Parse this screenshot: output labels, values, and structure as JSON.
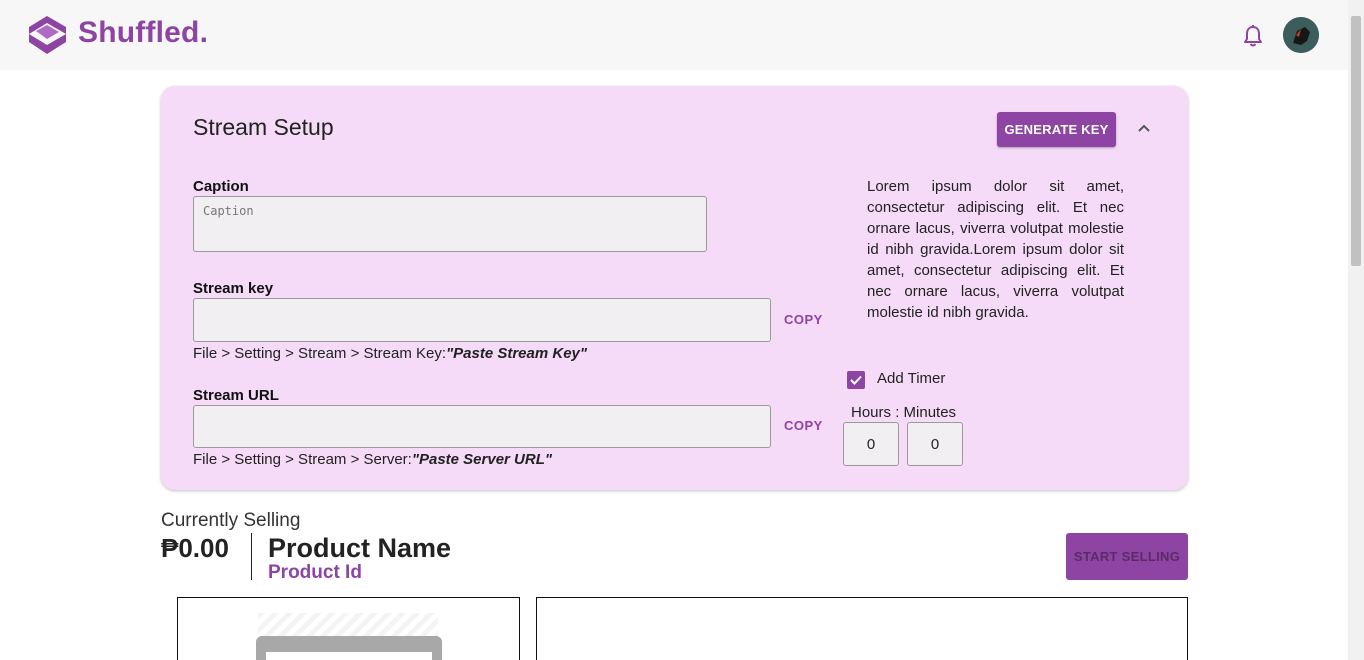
{
  "header": {
    "brand": "Shuffled.",
    "logo_icon": "shuffled-logo-icon",
    "notification_icon": "bell-icon",
    "avatar_icon": "user-avatar"
  },
  "colors": {
    "accent": "#8e44a3",
    "panel_bg": "#f5dbf8"
  },
  "stream_setup": {
    "title": "Stream Setup",
    "generate_key_label": "GENERATE KEY",
    "collapse_icon": "chevron-up-icon",
    "caption": {
      "label": "Caption",
      "placeholder": "Caption",
      "value": ""
    },
    "stream_key": {
      "label": "Stream key",
      "value": "",
      "copy_label": "COPY",
      "hint_prefix": "File > Setting > Stream > Stream Key:",
      "hint_emphasis": "\"Paste Stream Key\""
    },
    "stream_url": {
      "label": "Stream URL",
      "value": "",
      "copy_label": "COPY",
      "hint_prefix": "File > Setting > Stream > Server:",
      "hint_emphasis": "\"Paste Server URL\""
    },
    "description": "Lorem ipsum dolor sit amet, consectetur adipiscing elit. Et nec ornare lacus, viverra volutpat molestie id nibh gravida.Lorem ipsum dolor sit amet, consectetur adipiscing elit. Et nec ornare lacus, viverra volutpat molestie id nibh gravida.",
    "timer": {
      "checked": true,
      "label": "Add Timer",
      "hours_label": "Hours",
      "separator": ":",
      "minutes_label": "Minutes",
      "hours": "0",
      "minutes": "0"
    }
  },
  "selling": {
    "heading": "Currently Selling",
    "price": "₱0.00",
    "product_name": "Product Name",
    "product_id": "Product Id",
    "start_label": "START SELLING"
  }
}
